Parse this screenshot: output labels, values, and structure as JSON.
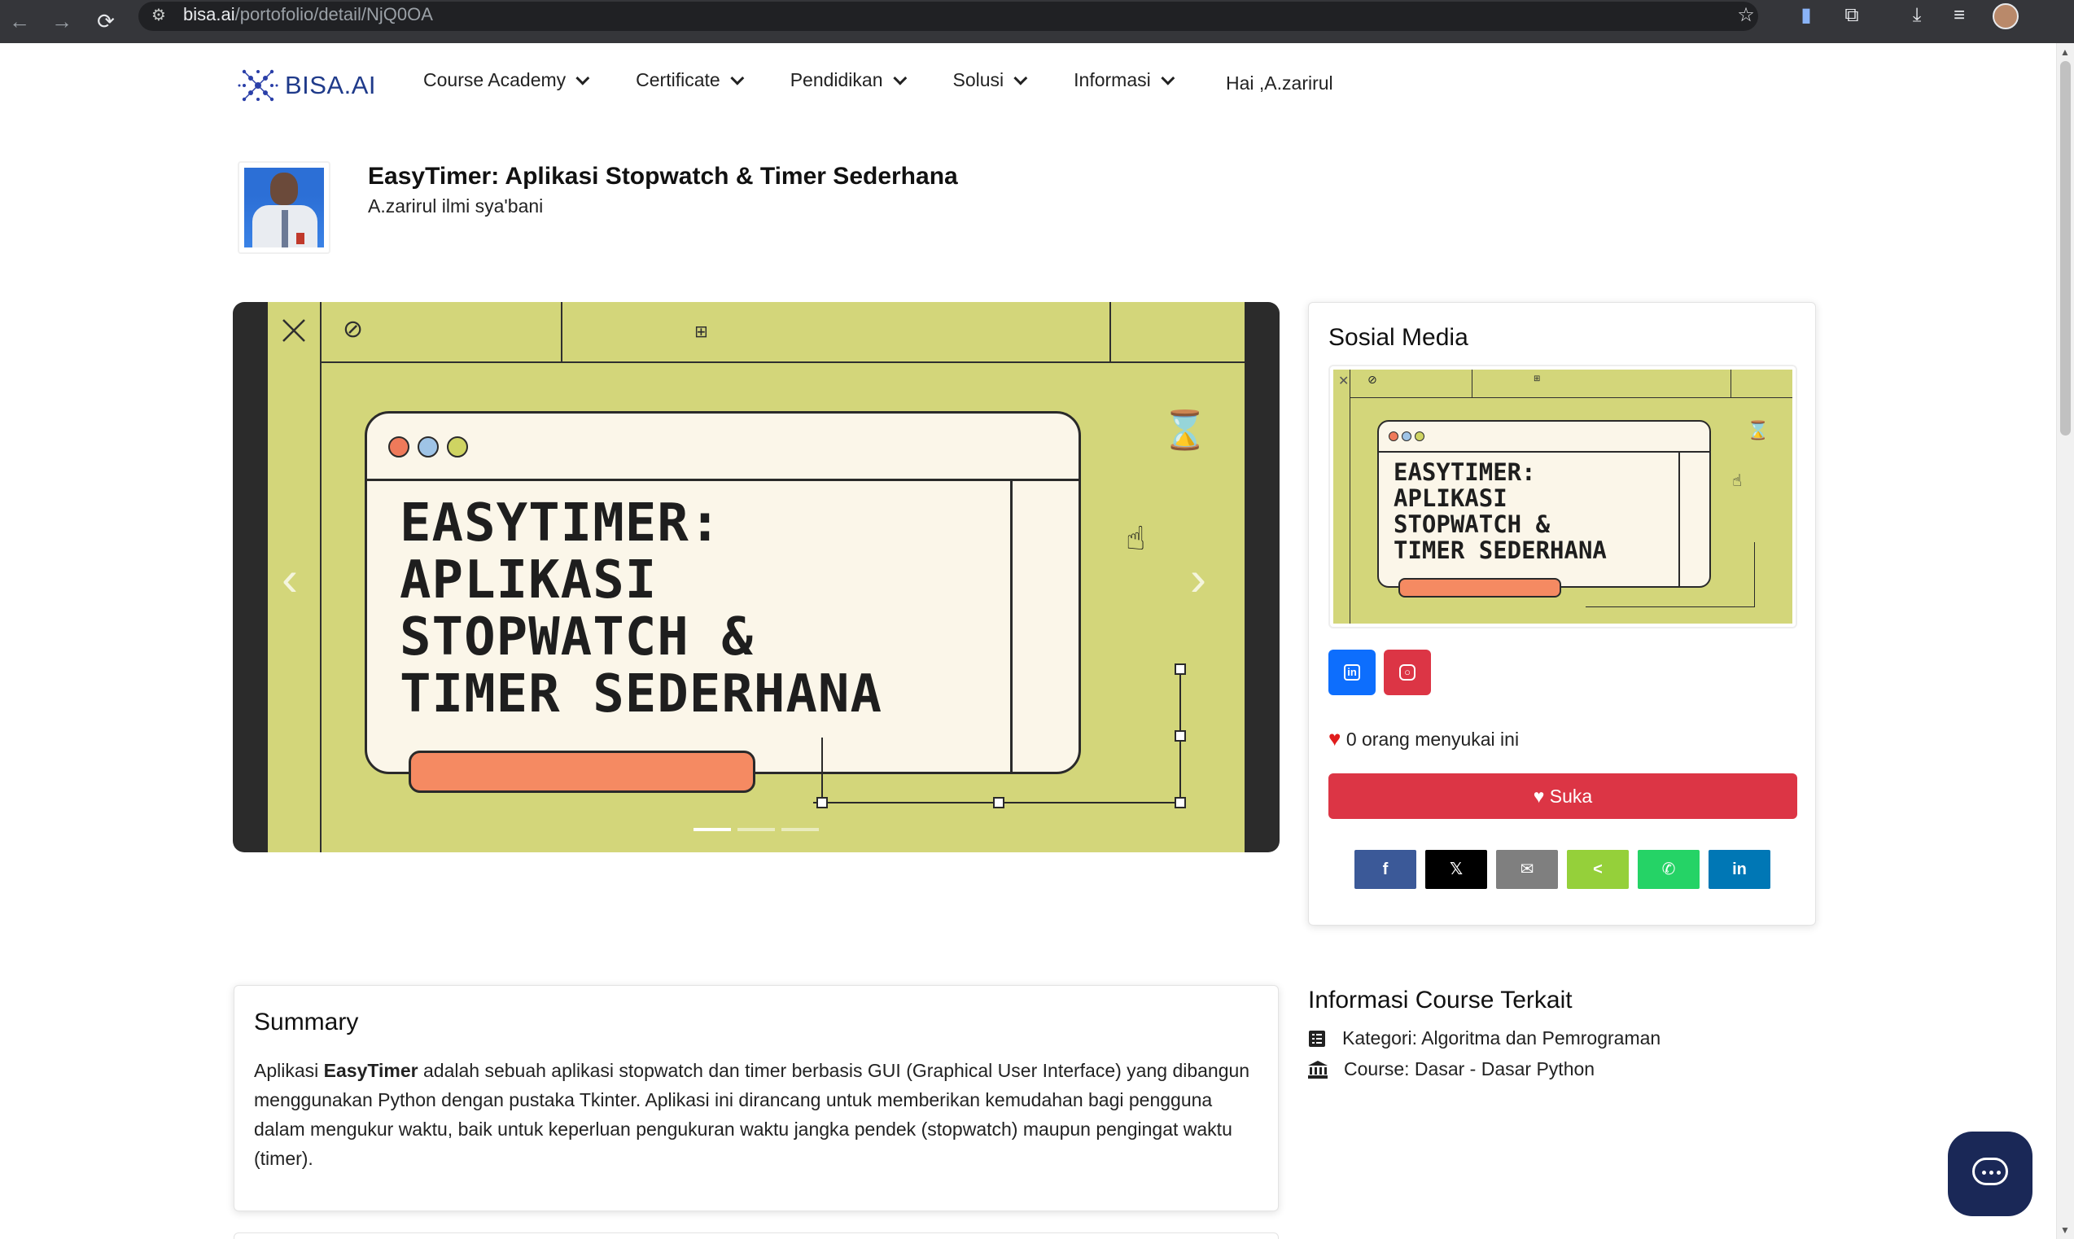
{
  "browser": {
    "url_host": "bisa.ai",
    "url_path": "/portofolio/detail/NjQ0OA",
    "back": "←",
    "forward": "→",
    "reload": "⟳"
  },
  "nav": {
    "logo_text": "BISA.AI",
    "items": [
      "Course Academy",
      "Certificate",
      "Pendidikan",
      "Solusi",
      "Informasi"
    ],
    "greeting": "Hai ,A.zarirul"
  },
  "project": {
    "title": "EasyTimer: Aplikasi Stopwatch & Timer Sederhana",
    "author": "A.zarirul ilmi sya'bani"
  },
  "slide": {
    "title_lines": [
      "EASYTIMER:",
      "APLIKASI",
      "STOPWATCH &",
      "TIMER SEDERHANA"
    ],
    "dot_colors": [
      "#ef7a5a",
      "#9fc4e6",
      "#cfd462"
    ],
    "prev": "‹",
    "next": "›",
    "indicator_count": 3,
    "active_index": 0
  },
  "social": {
    "heading": "Sosial Media",
    "likes_text": "0 orang menyukai ini",
    "like_button": "Suka",
    "share": [
      {
        "icon": "f",
        "color": "#3b5998"
      },
      {
        "icon": "𝕏",
        "color": "#000000"
      },
      {
        "icon": "✉",
        "color": "#7f7f7f"
      },
      {
        "icon": "<",
        "color": "#95d03a"
      },
      {
        "icon": "✆",
        "color": "#25d366"
      },
      {
        "icon": "in",
        "color": "#0077b5"
      }
    ]
  },
  "summary": {
    "heading": "Summary",
    "lead": "Aplikasi ",
    "bold": "EasyTimer",
    "rest": " adalah sebuah aplikasi stopwatch dan timer berbasis GUI (Graphical User Interface) yang dibangun menggunakan Python dengan pustaka Tkinter. Aplikasi ini dirancang untuk memberikan kemudahan bagi pengguna dalam mengukur waktu, baik untuk keperluan pengukuran waktu jangka pendek (stopwatch) maupun pengingat waktu (timer)."
  },
  "course_info": {
    "heading": "Informasi Course Terkait",
    "kategori": "Kategori: Algoritma dan Pemrograman",
    "course": "Course: Dasar - Dasar Python"
  }
}
